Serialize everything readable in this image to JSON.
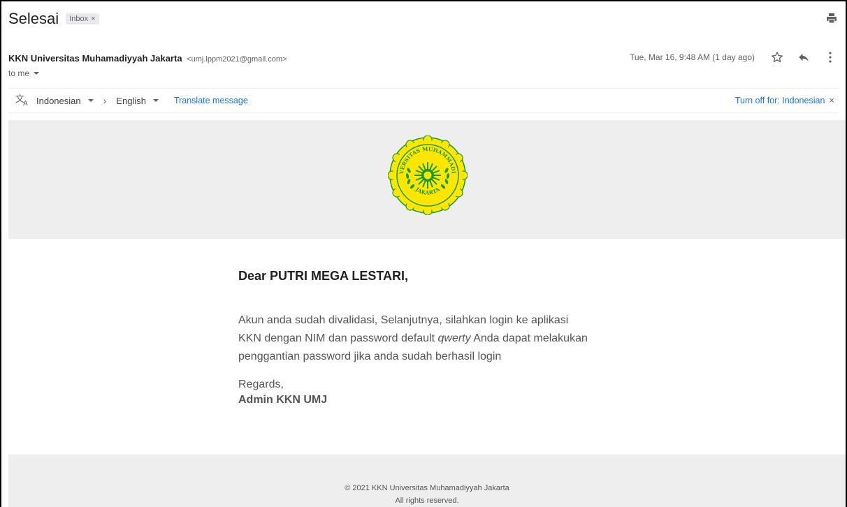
{
  "subject": "Selesai",
  "label_badge": "Inbox",
  "sender": {
    "name": "KKN Universitas Muhamadiyyah Jakarta",
    "email": "<umj.lppm2021@gmail.com>",
    "to": "to me"
  },
  "date": "Tue, Mar 16, 9:48 AM (1 day ago)",
  "translate": {
    "from_lang": "Indonesian",
    "to_lang": "English",
    "translate_link": "Translate message",
    "turn_off": "Turn off for: Indonesian"
  },
  "logo": {
    "text_top": "UNIVERSITAS MUHAMMADIYAH",
    "text_bottom": "JAKARTA",
    "color_primary": "#ffe600",
    "color_secondary": "#1a9a33"
  },
  "body": {
    "greeting": "Dear PUTRI MEGA LESTARI,",
    "line1": "Akun anda sudah divalidasi, Selanjutnya, silahkan login ke aplikasi",
    "line2_start": "KKN dengan NIM dan password default ",
    "line2_password": "qwerty",
    "line2_end": " Anda dapat melakukan",
    "line3": "penggantian password jika anda sudah berhasil login",
    "regards": "Regards,",
    "signer": "Admin KKN UMJ"
  },
  "footer": {
    "line1": "© 2021 KKN Universitas Muhamadiyyah Jakarta",
    "line2": "All rights reserved."
  },
  "icons": {
    "print": "print-icon",
    "star": "star-icon",
    "reply": "reply-icon",
    "more": "more-vertical-icon",
    "translate": "translate-icon"
  }
}
